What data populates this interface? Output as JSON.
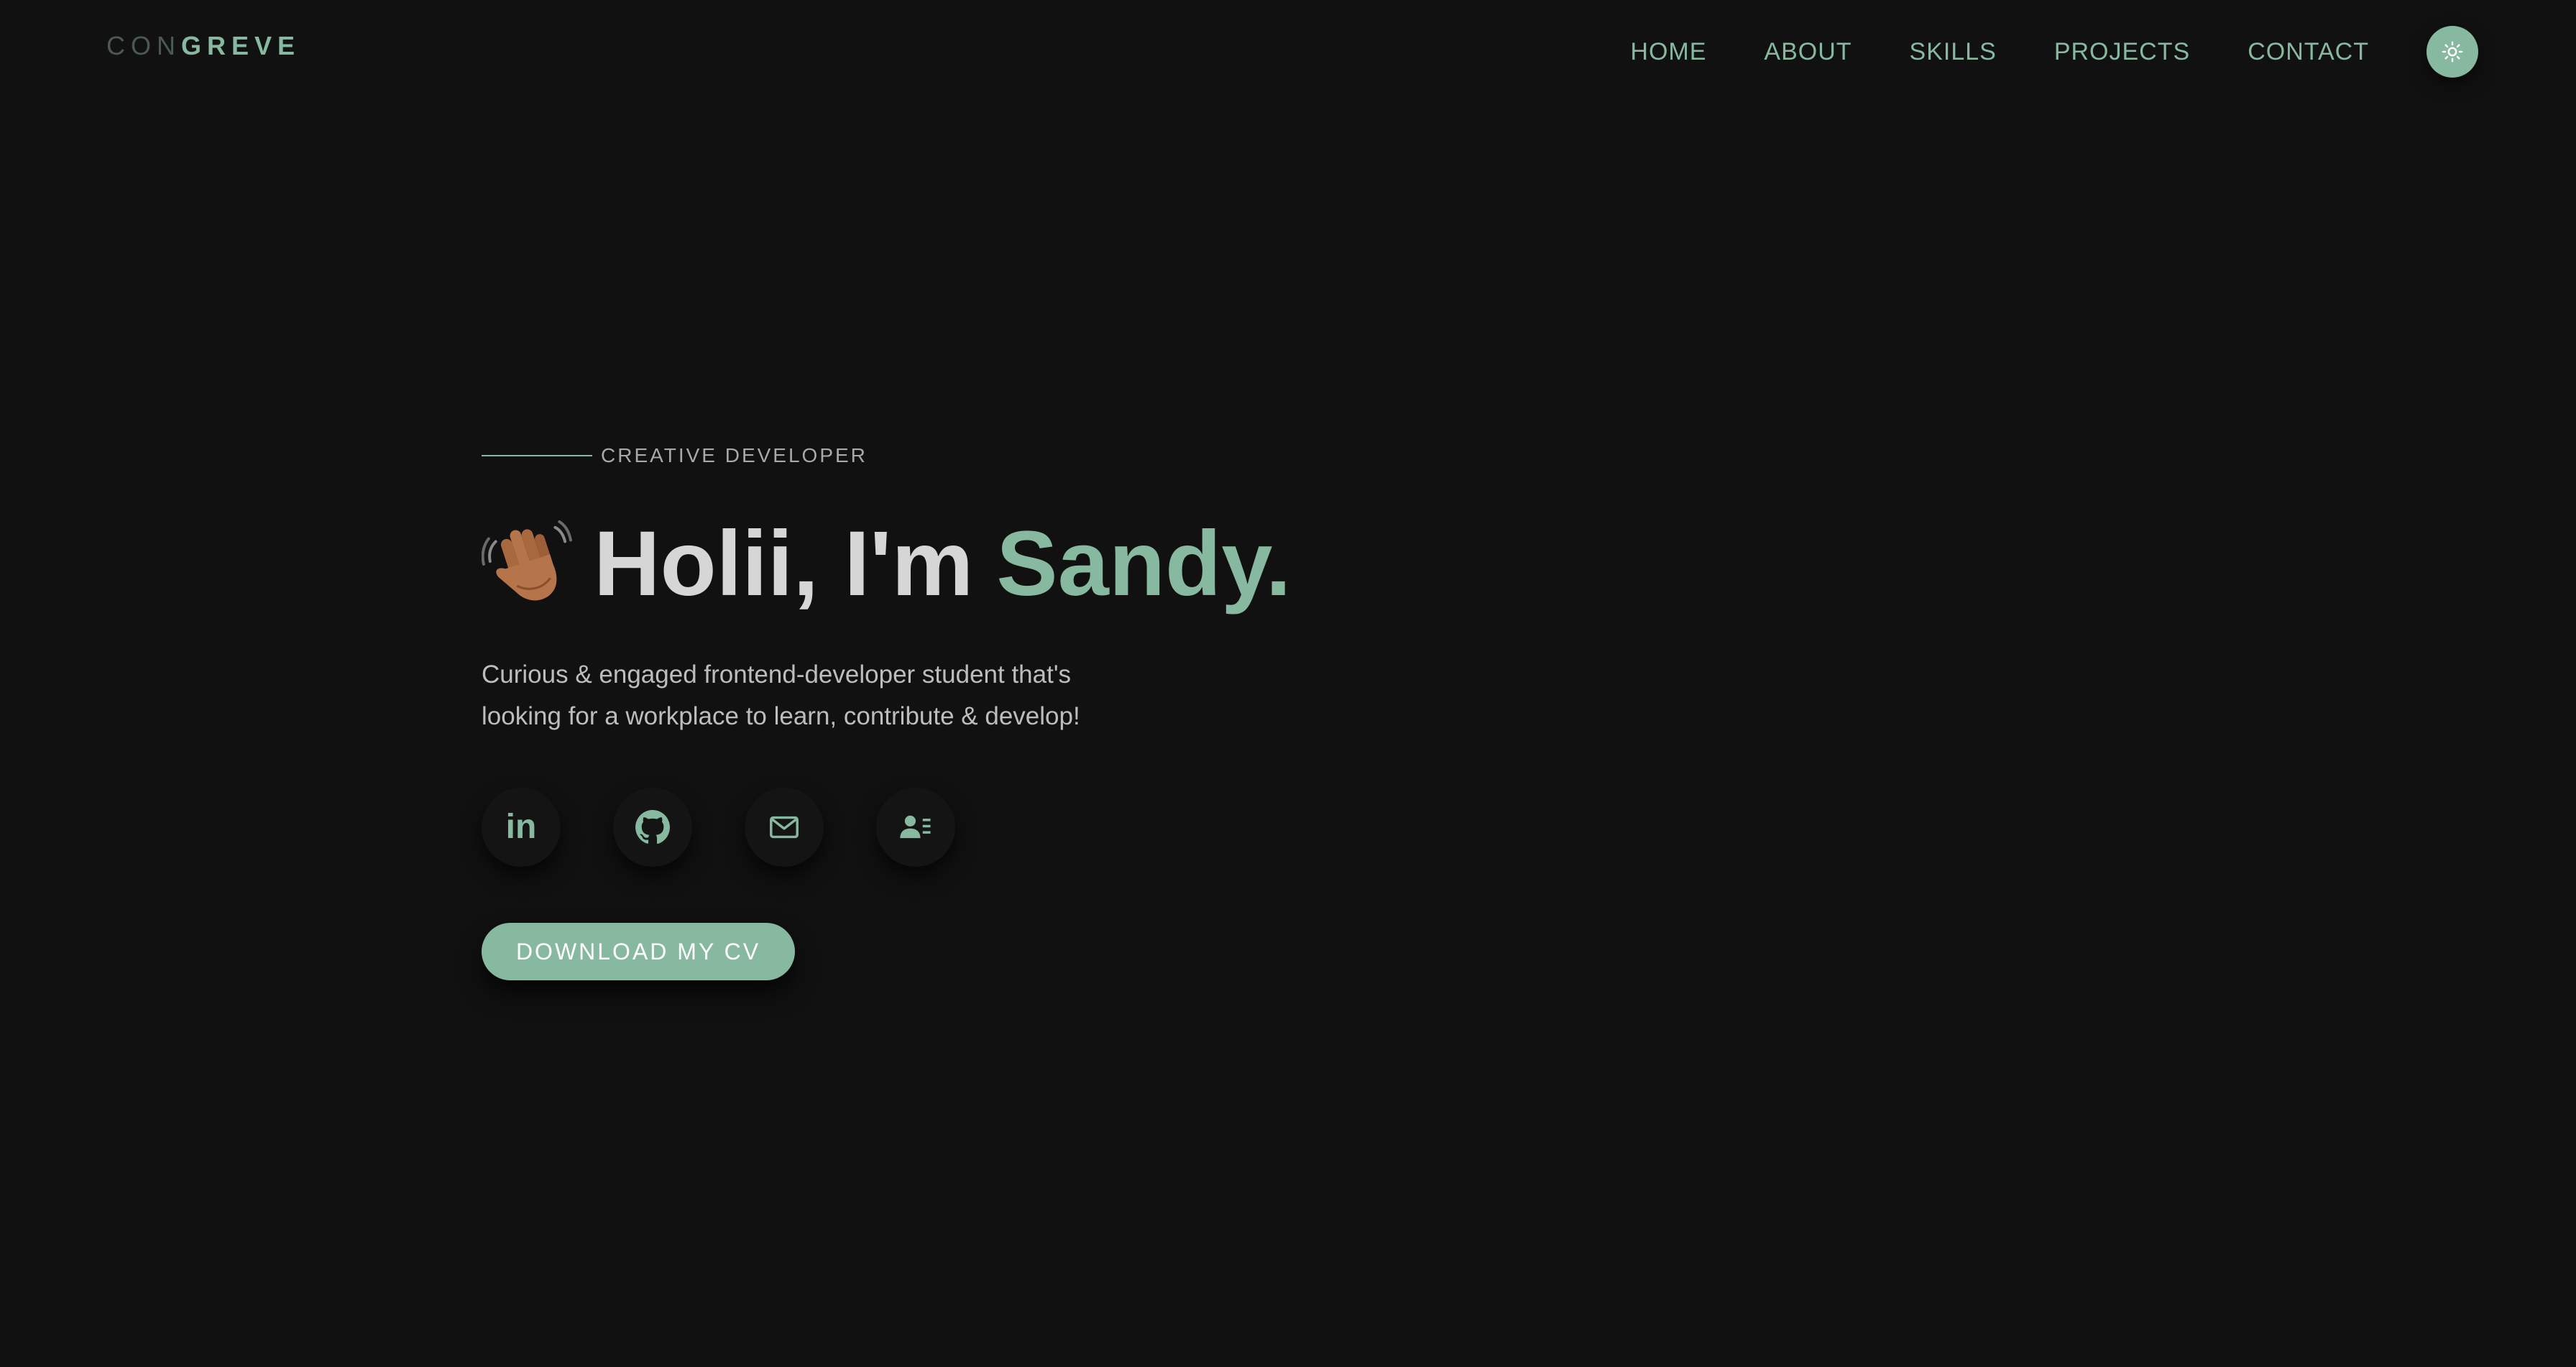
{
  "logo": {
    "light": "CON",
    "bold": "GREVE"
  },
  "nav": {
    "items": [
      {
        "label": "HOME"
      },
      {
        "label": "ABOUT"
      },
      {
        "label": "SKILLS"
      },
      {
        "label": "PROJECTS"
      },
      {
        "label": "CONTACT"
      }
    ],
    "theme_toggle_icon": "sun-icon"
  },
  "hero": {
    "kicker": "CREATIVE DEVELOPER",
    "wave_icon": "waving-hand-icon",
    "greeting": "Holii, I'm",
    "name": "Sandy.",
    "description_line1": "Curious & engaged frontend-developer student that's",
    "description_line2": "looking for a workplace to learn, contribute & develop!",
    "socials": [
      {
        "icon": "linkedin-icon",
        "text": "in"
      },
      {
        "icon": "github-icon"
      },
      {
        "icon": "mail-icon"
      },
      {
        "icon": "contact-card-icon"
      }
    ],
    "cv_button": "DOWNLOAD MY CV"
  },
  "colors": {
    "background": "#111111",
    "accent": "#86b9a0",
    "text_primary": "#d6d6d6",
    "text_secondary": "#bdbdbd"
  }
}
